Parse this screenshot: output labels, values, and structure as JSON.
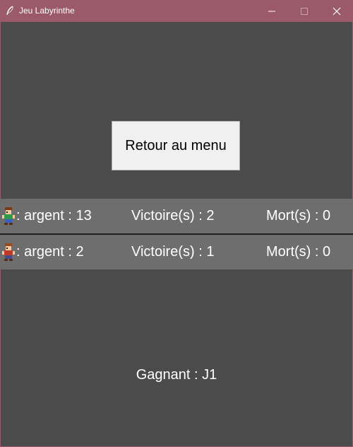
{
  "window": {
    "title": "Jeu Labyrinthe",
    "controls": [
      "minimize-icon",
      "maximize-icon",
      "close-icon"
    ],
    "titlebar_color": "#9b5a6a",
    "background_color": "#4b4b4b"
  },
  "menu_button": {
    "label": "Retour au menu"
  },
  "players": [
    {
      "avatar": "player-1-sprite-icon",
      "money": ": argent : 13",
      "wins": "Victoire(s) : 2",
      "deaths": "Mort(s) : 0"
    },
    {
      "avatar": "player-2-sprite-icon",
      "money": ": argent : 2",
      "wins": "Victoire(s) : 1",
      "deaths": "Mort(s) : 0"
    }
  ],
  "result": {
    "winner": "Gagnant : J1"
  },
  "colors": {
    "row_background": "#6e6e6e",
    "text": "#ffffff"
  }
}
